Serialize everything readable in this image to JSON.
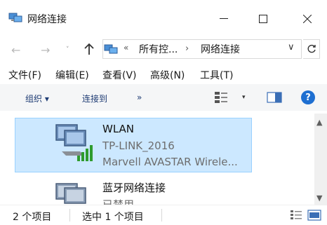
{
  "window": {
    "title": "网络连接",
    "icon": "network-connections-icon",
    "controls": {
      "minimize": "—",
      "maximize": "☐",
      "close": "✕"
    }
  },
  "address": {
    "back_glyph": "←",
    "forward_glyph": "→",
    "recent_glyph": "˅",
    "sep1": "«",
    "crumb1": "所有控...",
    "sep2": "›",
    "crumb2": "网络连接",
    "dropdown_glyph": "∨"
  },
  "menu": {
    "file": "文件(F)",
    "edit": "编辑(E)",
    "view": "查看(V)",
    "advanced": "高级(N)",
    "tools": "工具(T)"
  },
  "commands": {
    "organize": "组织 ▾",
    "connect_to": "连接到",
    "more": "»",
    "view_arrow": "▾",
    "help": "?"
  },
  "items": [
    {
      "name": "WLAN",
      "status": "TP-LINK_2016",
      "device": "Marvell AVASTAR Wirele...",
      "selected": true
    },
    {
      "name": "蓝牙网络连接",
      "status": "已禁用",
      "selected": false
    }
  ],
  "scrollbar": {
    "up": "▲",
    "down": "▼"
  },
  "statusbar": {
    "item_count": "2 个项目",
    "selected_count": "选中 1 个项目"
  },
  "colors": {
    "selection_bg": "#cce8ff",
    "selection_border": "#99d1ff",
    "command_text": "#1e3b73",
    "help_blue": "#1e6fd1",
    "signal_green": "#2e9b2e"
  }
}
